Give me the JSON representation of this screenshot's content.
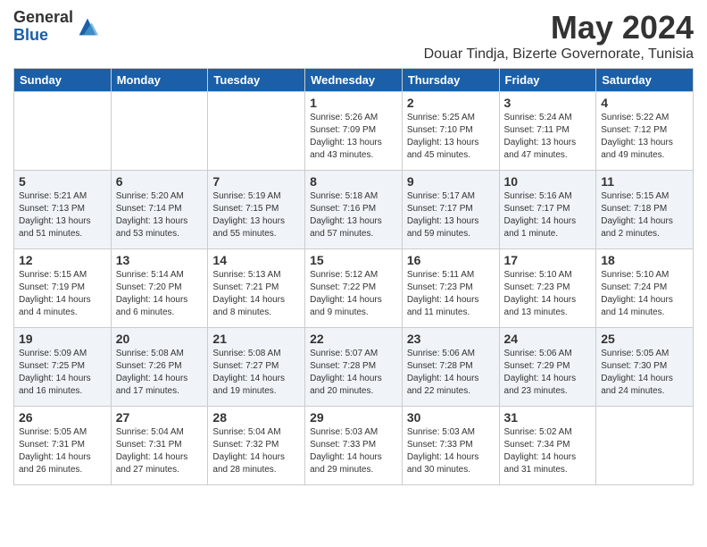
{
  "header": {
    "logo_general": "General",
    "logo_blue": "Blue",
    "month": "May 2024",
    "location": "Douar Tindja, Bizerte Governorate, Tunisia"
  },
  "weekdays": [
    "Sunday",
    "Monday",
    "Tuesday",
    "Wednesday",
    "Thursday",
    "Friday",
    "Saturday"
  ],
  "weeks": [
    [
      {
        "day": "",
        "info": ""
      },
      {
        "day": "",
        "info": ""
      },
      {
        "day": "",
        "info": ""
      },
      {
        "day": "1",
        "info": "Sunrise: 5:26 AM\nSunset: 7:09 PM\nDaylight: 13 hours\nand 43 minutes."
      },
      {
        "day": "2",
        "info": "Sunrise: 5:25 AM\nSunset: 7:10 PM\nDaylight: 13 hours\nand 45 minutes."
      },
      {
        "day": "3",
        "info": "Sunrise: 5:24 AM\nSunset: 7:11 PM\nDaylight: 13 hours\nand 47 minutes."
      },
      {
        "day": "4",
        "info": "Sunrise: 5:22 AM\nSunset: 7:12 PM\nDaylight: 13 hours\nand 49 minutes."
      }
    ],
    [
      {
        "day": "5",
        "info": "Sunrise: 5:21 AM\nSunset: 7:13 PM\nDaylight: 13 hours\nand 51 minutes."
      },
      {
        "day": "6",
        "info": "Sunrise: 5:20 AM\nSunset: 7:14 PM\nDaylight: 13 hours\nand 53 minutes."
      },
      {
        "day": "7",
        "info": "Sunrise: 5:19 AM\nSunset: 7:15 PM\nDaylight: 13 hours\nand 55 minutes."
      },
      {
        "day": "8",
        "info": "Sunrise: 5:18 AM\nSunset: 7:16 PM\nDaylight: 13 hours\nand 57 minutes."
      },
      {
        "day": "9",
        "info": "Sunrise: 5:17 AM\nSunset: 7:17 PM\nDaylight: 13 hours\nand 59 minutes."
      },
      {
        "day": "10",
        "info": "Sunrise: 5:16 AM\nSunset: 7:17 PM\nDaylight: 14 hours\nand 1 minute."
      },
      {
        "day": "11",
        "info": "Sunrise: 5:15 AM\nSunset: 7:18 PM\nDaylight: 14 hours\nand 2 minutes."
      }
    ],
    [
      {
        "day": "12",
        "info": "Sunrise: 5:15 AM\nSunset: 7:19 PM\nDaylight: 14 hours\nand 4 minutes."
      },
      {
        "day": "13",
        "info": "Sunrise: 5:14 AM\nSunset: 7:20 PM\nDaylight: 14 hours\nand 6 minutes."
      },
      {
        "day": "14",
        "info": "Sunrise: 5:13 AM\nSunset: 7:21 PM\nDaylight: 14 hours\nand 8 minutes."
      },
      {
        "day": "15",
        "info": "Sunrise: 5:12 AM\nSunset: 7:22 PM\nDaylight: 14 hours\nand 9 minutes."
      },
      {
        "day": "16",
        "info": "Sunrise: 5:11 AM\nSunset: 7:23 PM\nDaylight: 14 hours\nand 11 minutes."
      },
      {
        "day": "17",
        "info": "Sunrise: 5:10 AM\nSunset: 7:23 PM\nDaylight: 14 hours\nand 13 minutes."
      },
      {
        "day": "18",
        "info": "Sunrise: 5:10 AM\nSunset: 7:24 PM\nDaylight: 14 hours\nand 14 minutes."
      }
    ],
    [
      {
        "day": "19",
        "info": "Sunrise: 5:09 AM\nSunset: 7:25 PM\nDaylight: 14 hours\nand 16 minutes."
      },
      {
        "day": "20",
        "info": "Sunrise: 5:08 AM\nSunset: 7:26 PM\nDaylight: 14 hours\nand 17 minutes."
      },
      {
        "day": "21",
        "info": "Sunrise: 5:08 AM\nSunset: 7:27 PM\nDaylight: 14 hours\nand 19 minutes."
      },
      {
        "day": "22",
        "info": "Sunrise: 5:07 AM\nSunset: 7:28 PM\nDaylight: 14 hours\nand 20 minutes."
      },
      {
        "day": "23",
        "info": "Sunrise: 5:06 AM\nSunset: 7:28 PM\nDaylight: 14 hours\nand 22 minutes."
      },
      {
        "day": "24",
        "info": "Sunrise: 5:06 AM\nSunset: 7:29 PM\nDaylight: 14 hours\nand 23 minutes."
      },
      {
        "day": "25",
        "info": "Sunrise: 5:05 AM\nSunset: 7:30 PM\nDaylight: 14 hours\nand 24 minutes."
      }
    ],
    [
      {
        "day": "26",
        "info": "Sunrise: 5:05 AM\nSunset: 7:31 PM\nDaylight: 14 hours\nand 26 minutes."
      },
      {
        "day": "27",
        "info": "Sunrise: 5:04 AM\nSunset: 7:31 PM\nDaylight: 14 hours\nand 27 minutes."
      },
      {
        "day": "28",
        "info": "Sunrise: 5:04 AM\nSunset: 7:32 PM\nDaylight: 14 hours\nand 28 minutes."
      },
      {
        "day": "29",
        "info": "Sunrise: 5:03 AM\nSunset: 7:33 PM\nDaylight: 14 hours\nand 29 minutes."
      },
      {
        "day": "30",
        "info": "Sunrise: 5:03 AM\nSunset: 7:33 PM\nDaylight: 14 hours\nand 30 minutes."
      },
      {
        "day": "31",
        "info": "Sunrise: 5:02 AM\nSunset: 7:34 PM\nDaylight: 14 hours\nand 31 minutes."
      },
      {
        "day": "",
        "info": ""
      }
    ]
  ]
}
